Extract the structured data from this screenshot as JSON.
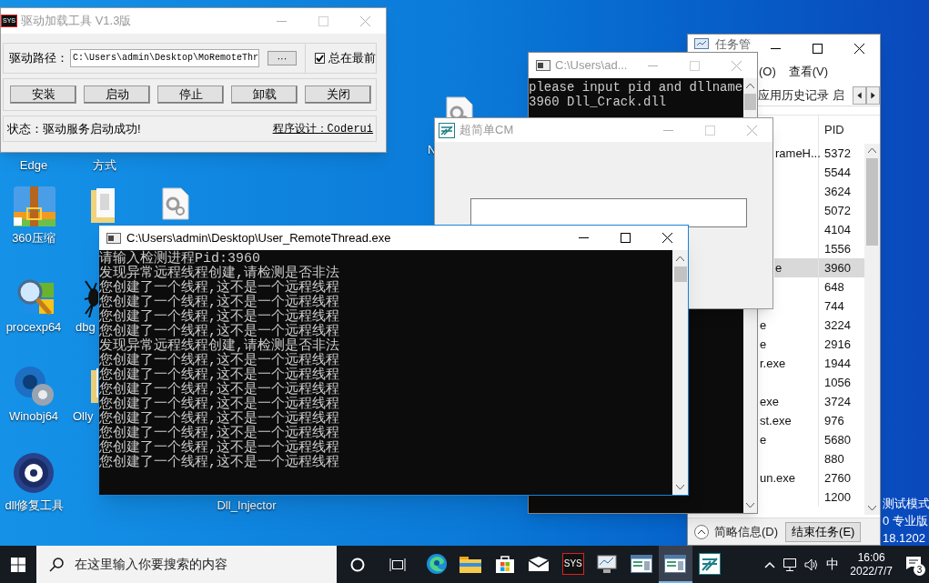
{
  "desktop": {
    "icons": [
      {
        "kind": "none",
        "label": "Edge"
      },
      {
        "kind": "none",
        "label": "方式"
      },
      {
        "kind": "zip",
        "label": "360压缩"
      },
      {
        "kind": "folder"
      },
      {
        "kind": "gear_file"
      },
      {
        "kind": "procexp",
        "label": "procexp64"
      },
      {
        "kind": "spider",
        "label": "dbg"
      },
      {
        "kind": "gear",
        "label": "Winobj64"
      },
      {
        "kind": "folder",
        "label": "Olly"
      },
      {
        "kind": "repair",
        "label": "dll修复工具"
      },
      {
        "kind": "none",
        "label": "Dll_Injector"
      },
      {
        "kind": "gear_file",
        "label": "N"
      }
    ],
    "side_text": [
      "测试模式",
      "0 专业版",
      "18.1202"
    ]
  },
  "task_manager": {
    "title": "任务管",
    "menu": [
      "(O)",
      "查看(V)"
    ],
    "tabs": [
      "应用历史记录",
      "启"
    ],
    "columns": [
      "PID"
    ],
    "rows": [
      {
        "name": "rameH...",
        "pid": "5372",
        "selected": false
      },
      {
        "pid": "5544",
        "selected": false
      },
      {
        "pid": "3624",
        "selected": false
      },
      {
        "pid": "5072",
        "selected": false
      },
      {
        "pid": "4104",
        "selected": false
      },
      {
        "pid": "1556",
        "selected": false
      },
      {
        "name": "e",
        "pid": "3960",
        "selected": true
      },
      {
        "pid": "648",
        "selected": false
      },
      {
        "pid": "744",
        "selected": false
      },
      {
        "name": "e",
        "pid": "3224",
        "selected": false
      },
      {
        "name": "e",
        "pid": "2916",
        "selected": false
      },
      {
        "name": "r.exe",
        "pid": "1944",
        "selected": false
      },
      {
        "pid": "1056",
        "selected": false
      },
      {
        "name": "exe",
        "pid": "3724",
        "selected": false
      },
      {
        "name": "st.exe",
        "pid": "976",
        "selected": false
      },
      {
        "name": "e",
        "pid": "5680",
        "selected": false
      },
      {
        "pid": "880",
        "selected": false
      },
      {
        "name": "un.exe",
        "pid": "2760",
        "selected": false
      },
      {
        "pid": "1200",
        "selected": false
      }
    ],
    "details_toggle": "简略信息(D)",
    "end_task_button": "结束任务(E)"
  },
  "console_small": {
    "title": "C:\\Users\\ad...",
    "lines": [
      "please input pid and dllname",
      "3960 Dll_Crack.dll"
    ]
  },
  "crackme": {
    "title": "超简单CM"
  },
  "console_main": {
    "title": "C:\\Users\\admin\\Desktop\\User_RemoteThread.exe",
    "lines": [
      "请输入检测进程Pid:3960",
      "发现异常远程线程创建,请检测是否非法",
      "您创建了一个线程,这不是一个远程线程",
      "您创建了一个线程,这不是一个远程线程",
      "您创建了一个线程,这不是一个远程线程",
      "您创建了一个线程,这不是一个远程线程",
      "发现异常远程线程创建,请检测是否非法",
      "您创建了一个线程,这不是一个远程线程",
      "您创建了一个线程,这不是一个远程线程",
      "您创建了一个线程,这不是一个远程线程",
      "您创建了一个线程,这不是一个远程线程",
      "您创建了一个线程,这不是一个远程线程",
      "您创建了一个线程,这不是一个远程线程",
      "您创建了一个线程,这不是一个远程线程",
      "您创建了一个线程,这不是一个远程线程"
    ]
  },
  "driver_tool": {
    "icon_text": "SYS",
    "title": "驱动加载工具 V1.3版",
    "path_label": "驱动路径：",
    "path_value": "C:\\Users\\admin\\Desktop\\MoRemoteThr",
    "browse_button": "···",
    "always_on_top": {
      "label": "总在最前",
      "checked": true
    },
    "buttons": [
      "安装",
      "启动",
      "停止",
      "卸载",
      "关闭"
    ],
    "status": "状态：驱动服务启动成功!",
    "credit": "程序设计：Coderui"
  },
  "taskbar": {
    "search_placeholder": "在这里输入你要搜索的内容",
    "apps": [
      {
        "kind": "edge",
        "selected": false
      },
      {
        "kind": "explorer",
        "selected": false
      },
      {
        "kind": "store",
        "selected": false
      },
      {
        "kind": "mail",
        "selected": false
      },
      {
        "kind": "sys",
        "text": "SYS",
        "selected": false
      },
      {
        "kind": "monitor",
        "selected": false
      },
      {
        "kind": "window",
        "selected": false
      },
      {
        "kind": "window",
        "selected": true
      },
      {
        "kind": "easy",
        "selected": false
      }
    ],
    "ime": "中",
    "time": "16:06",
    "date": "2022/7/7",
    "notification_count": "3"
  }
}
